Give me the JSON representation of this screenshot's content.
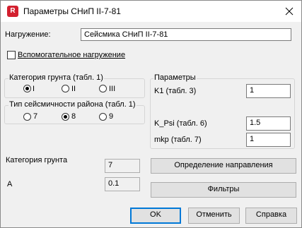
{
  "window": {
    "title": "Параметры СНиП II-7-81",
    "app_icon_letter": "R"
  },
  "load": {
    "label": "Нагружение:",
    "value": "Сейсмика СНиП II-7-81"
  },
  "auxiliary": {
    "label": "Вспомогательное нагружение",
    "checked": false
  },
  "soil_category_group": {
    "title": "Категория грунта (табл. 1)",
    "options": [
      "I",
      "II",
      "III"
    ],
    "selected": "I"
  },
  "seismicity_group": {
    "title": "Тип сейсмичности района (табл. 1)",
    "options": [
      "7",
      "8",
      "9"
    ],
    "selected": "8"
  },
  "params_group": {
    "title": "Параметры",
    "k1_label": "K1 (табл. 3)",
    "k1_value": "1",
    "kpsi_label": "K_Psi (табл. 6)",
    "kpsi_value": "1.5",
    "mkp_label": "mkp (табл. 7)",
    "mkp_value": "1"
  },
  "readouts": {
    "soil_category_label": "Категория грунта",
    "soil_category_value": "7",
    "a_label": "A",
    "a_value": "0.1"
  },
  "buttons": {
    "direction": "Определение направления",
    "filters": "Фильтры",
    "ok": "OK",
    "cancel": "Отменить",
    "help": "Справка"
  }
}
